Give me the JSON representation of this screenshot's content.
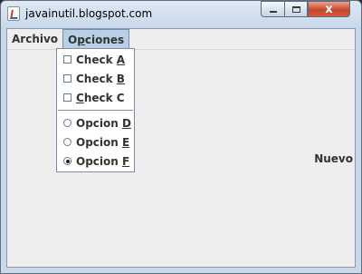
{
  "window": {
    "title": "javainutil.blogspot.com"
  },
  "controls": {
    "minimize_icon": "minimize-icon",
    "maximize_icon": "maximize-icon",
    "close_glyph": "x"
  },
  "menubar": {
    "menus": [
      {
        "label": "Archivo"
      },
      {
        "label_pre": "O",
        "mnemonic": "p",
        "label_post": "ciones"
      }
    ]
  },
  "popup": {
    "checks": [
      {
        "pre": "Check ",
        "mnemonic": "A",
        "post": "",
        "checked": false
      },
      {
        "pre": "Check ",
        "mnemonic": "B",
        "post": "",
        "checked": false
      },
      {
        "pre": "",
        "mnemonic": "C",
        "post": "heck C",
        "checked": false
      }
    ],
    "radios": [
      {
        "pre": "Opcion ",
        "mnemonic": "D",
        "post": "",
        "selected": false
      },
      {
        "pre": "Opcion ",
        "mnemonic": "E",
        "post": "",
        "selected": false
      },
      {
        "pre": "Opcion ",
        "mnemonic": "F",
        "post": "",
        "selected": true
      }
    ]
  },
  "content": {
    "label": "Nuevo"
  }
}
